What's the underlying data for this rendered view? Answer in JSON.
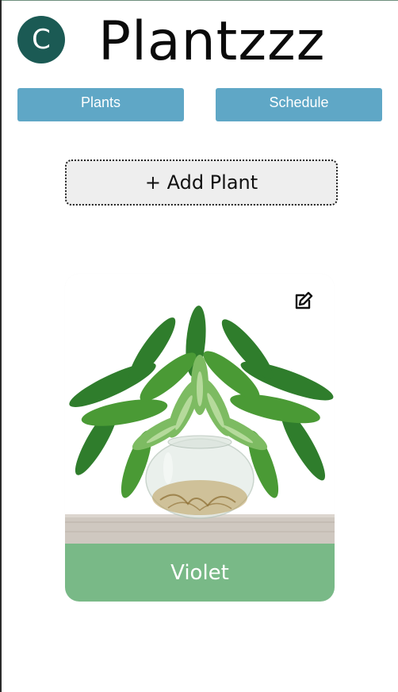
{
  "header": {
    "avatar_letter": "C",
    "title": "Plantzzz"
  },
  "nav": {
    "plants_label": "Plants",
    "schedule_label": "Schedule"
  },
  "actions": {
    "add_plant_label": "+ Add Plant"
  },
  "cards": [
    {
      "name": "Violet",
      "edit_icon": "edit-icon",
      "image": "potted-plant-in-glass-bowl"
    }
  ],
  "colors": {
    "avatar_bg": "#1b5a54",
    "nav_button_bg": "#5fa7c6",
    "card_label_bg": "#79b987",
    "add_button_bg": "#eeeeee"
  }
}
